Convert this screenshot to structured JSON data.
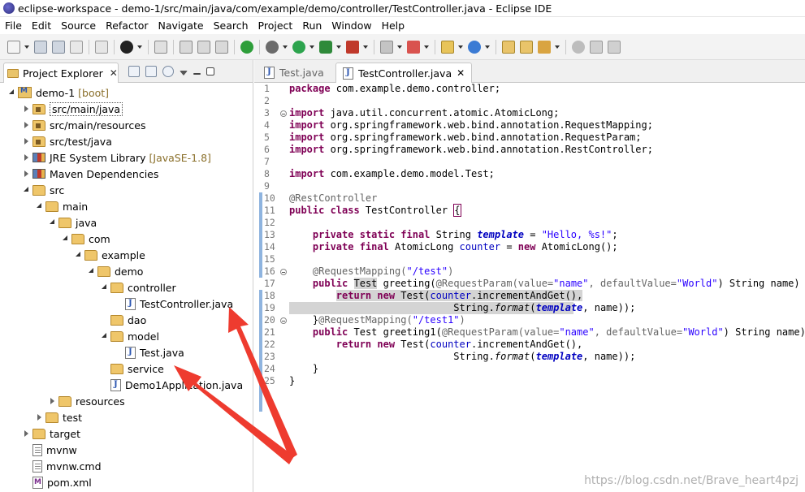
{
  "window": {
    "title": "eclipse-workspace - demo-1/src/main/java/com/example/demo/controller/TestController.java - Eclipse IDE"
  },
  "menu": [
    "File",
    "Edit",
    "Source",
    "Refactor",
    "Navigate",
    "Search",
    "Project",
    "Run",
    "Window",
    "Help"
  ],
  "explorer": {
    "tab_label": "Project Explorer",
    "close_glyph": "✕",
    "project": {
      "name": "demo-1",
      "decoration": "[boot]"
    },
    "items": {
      "src_main_java": "src/main/java",
      "src_main_resources": "src/main/resources",
      "src_test_java": "src/test/java",
      "jre": "JRE System Library",
      "jre_dec": "[JavaSE-1.8]",
      "maven": "Maven Dependencies",
      "src": "src",
      "main": "main",
      "java": "java",
      "com": "com",
      "example": "example",
      "demo": "demo",
      "controller": "controller",
      "testcontroller": "TestController.java",
      "dao": "dao",
      "model": "model",
      "test_java": "Test.java",
      "service": "service",
      "demo1app": "Demo1Application.java",
      "resources": "resources",
      "test": "test",
      "target": "target",
      "mvnw": "mvnw",
      "mvnw_cmd": "mvnw.cmd",
      "pom": "pom.xml"
    }
  },
  "editor": {
    "tabs": [
      {
        "label": "Test.java",
        "active": false
      },
      {
        "label": "TestController.java",
        "active": true
      }
    ],
    "close_glyph": "✕",
    "line_numbers": [
      "1",
      "2",
      "3",
      "4",
      "5",
      "6",
      "7",
      "8",
      "9",
      "10",
      "11",
      "12",
      "13",
      "14",
      "15",
      "16",
      "17",
      "18",
      "19",
      "20",
      "21",
      "22",
      "23",
      "24",
      "25"
    ],
    "code": {
      "l1a": "package",
      "l1b": " com.example.demo.controller;",
      "l3a": "import",
      "l3b": " java.util.concurrent.atomic.AtomicLong;",
      "l4a": "import",
      "l4b": " org.springframework.web.bind.annotation.RequestMapping;",
      "l5a": "import",
      "l5b": " org.springframework.web.bind.annotation.RequestParam;",
      "l6a": "import",
      "l6b": " org.springframework.web.bind.annotation.RestController;",
      "l8a": "import",
      "l8b": " com.example.demo.model.Test;",
      "l10": "@RestController",
      "l11a": "public class",
      "l11b": " TestController ",
      "l11c": "{",
      "l13a": "    ",
      "l13b": "private static final",
      "l13c": " String ",
      "l13d": "template",
      "l13e": " = ",
      "l13f": "\"Hello, %s!\"",
      "l13g": ";",
      "l14a": "    ",
      "l14b": "private final",
      "l14c": " AtomicLong ",
      "l14d": "counter",
      "l14e": " = ",
      "l14f": "new",
      "l14g": " AtomicLong();",
      "l16a": "    ",
      "l16b": "@RequestMapping(",
      "l16c": "\"/test\"",
      "l16d": ")",
      "l17a": "    ",
      "l17b": "public",
      "l17c": " ",
      "l17d": "Test",
      "l17e": " greeting(",
      "l17f": "@RequestParam(value=",
      "l17g": "\"name\"",
      "l17h": ", defaultValue=",
      "l17i": "\"World\"",
      "l17j": ") String name) {",
      "l18a": "        ",
      "l18b": "return new",
      "l18c": " Test(",
      "l18d": "counter",
      "l18e": ".incrementAndGet(),",
      "l19a": "                            String.",
      "l19b": "format",
      "l19c": "(",
      "l19d": "template",
      "l19e": ", name));",
      "l20a": "    }",
      "l20b": "@RequestMapping(",
      "l20c": "\"/test1\"",
      "l20d": ")",
      "l21a": "    ",
      "l21b": "public",
      "l21c": " Test greeting1(",
      "l21d": "@RequestParam(value=",
      "l21e": "\"name\"",
      "l21f": ", defaultValue=",
      "l21g": "\"World\"",
      "l21h": ") String name) {",
      "l22a": "        ",
      "l22b": "return new",
      "l22c": " Test(",
      "l22d": "counter",
      "l22e": ".incrementAndGet(),",
      "l23a": "                            String.",
      "l23b": "format",
      "l23c": "(",
      "l23d": "template",
      "l23e": ", name));",
      "l24": "    }",
      "l25": "}"
    }
  },
  "watermark": "https://blog.csdn.net/Brave_heart4pzj",
  "colors": {
    "keyword": "#7f0055",
    "string": "#2a00ff",
    "field": "#0000c0",
    "annotation": "#646464",
    "arrow": "#ee3b2f"
  }
}
